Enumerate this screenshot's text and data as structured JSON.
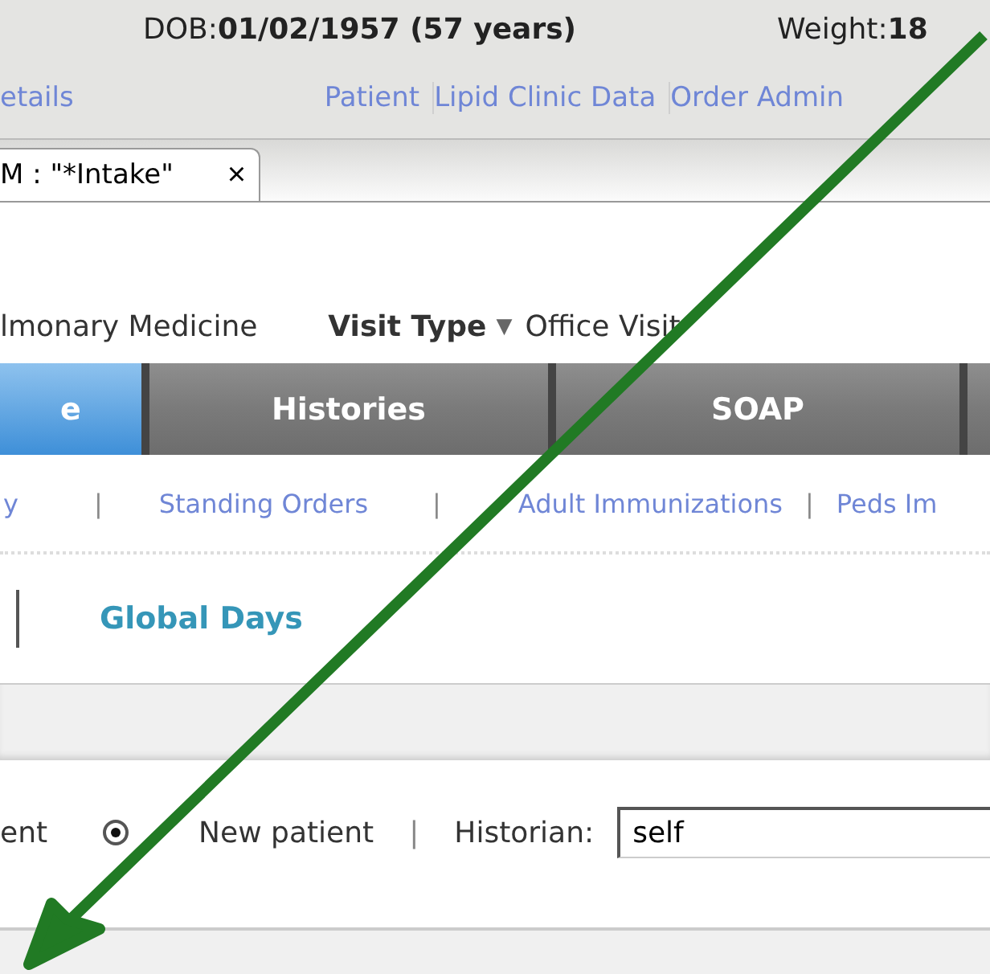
{
  "header": {
    "dob_label": "DOB:",
    "dob_value": "01/02/1957 (57 years)",
    "weight_label": "Weight:",
    "weight_value": "18"
  },
  "links": [
    {
      "label": "etails"
    },
    {
      "label": "Patient"
    },
    {
      "label": "Lipid Clinic Data"
    },
    {
      "label": "Order Admin"
    }
  ],
  "document_tab": {
    "label": "M : \"*Intake\"",
    "close": "×"
  },
  "visit": {
    "specialty": "lmonary Medicine",
    "type_label": "Visit Type",
    "type_caret": "▼",
    "type_value": "Office Visit"
  },
  "tabs": [
    {
      "label": "e",
      "selected": true
    },
    {
      "label": "Histories",
      "selected": false
    },
    {
      "label": "SOAP",
      "selected": false
    },
    {
      "selected": false
    }
  ],
  "sub_links": [
    {
      "kind": "link",
      "label": "y"
    },
    {
      "kind": "separator",
      "label": "|"
    },
    {
      "kind": "link",
      "label": "Standing Orders"
    },
    {
      "kind": "separator",
      "label": "|"
    },
    {
      "kind": "link",
      "label": "Adult Immunizations"
    },
    {
      "kind": "separator",
      "label": "|"
    },
    {
      "kind": "link",
      "label": "Peds Im"
    }
  ],
  "global_days": "Global Days",
  "patient_row": {
    "established_label": "ent",
    "new_patient": {
      "label": "New patient",
      "selected": true
    },
    "separator": "|",
    "historian_label": "Historian:",
    "historian_value": "self"
  }
}
